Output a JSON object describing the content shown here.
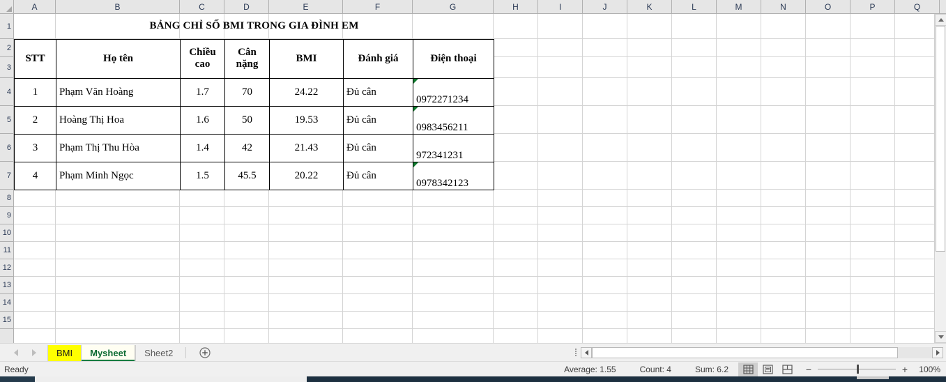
{
  "app": {
    "name": "Excel Spreadsheet"
  },
  "grid": {
    "column_headers": [
      "A",
      "B",
      "C",
      "D",
      "E",
      "F",
      "G",
      "H",
      "I",
      "J",
      "K",
      "L",
      "M",
      "N",
      "O",
      "P",
      "Q"
    ],
    "row_headers": [
      "1",
      "2",
      "3",
      "4",
      "5",
      "6",
      "7",
      "8",
      "9",
      "10",
      "11",
      "12",
      "13",
      "14",
      "15"
    ]
  },
  "sheet": {
    "title": "BẢNG CHỈ SỐ BMI TRONG GIA ĐÌNH EM",
    "table": {
      "headers": [
        "STT",
        "Họ tên",
        "Chiều cao",
        "Cân nặng",
        "BMI",
        "Đánh giá",
        "Điện thoại"
      ],
      "rows": [
        {
          "stt": "1",
          "name": "Phạm Văn Hoàng",
          "height": "1.7",
          "weight": "70",
          "bmi": "24.22",
          "rating": "Đủ cân",
          "phone": "0972271234"
        },
        {
          "stt": "2",
          "name": "Hoàng Thị Hoa",
          "height": "1.6",
          "weight": "50",
          "bmi": "19.53",
          "rating": "Đủ cân",
          "phone": "0983456211"
        },
        {
          "stt": "3",
          "name": "Phạm  Thị Thu Hòa",
          "height": "1.4",
          "weight": "42",
          "bmi": "21.43",
          "rating": "Đủ cân",
          "phone": "972341231"
        },
        {
          "stt": "4",
          "name": "Phạm Minh Ngọc",
          "height": "1.5",
          "weight": "45.5",
          "bmi": "20.22",
          "rating": "Đủ cân",
          "phone": "0978342123"
        }
      ]
    }
  },
  "tabs": {
    "items": [
      {
        "label": "BMI",
        "state": "yellow"
      },
      {
        "label": "Mysheet",
        "state": "active"
      },
      {
        "label": "Sheet2",
        "state": "plain"
      }
    ],
    "add_label": "+"
  },
  "status": {
    "ready": "Ready",
    "average": "Average: 1.55",
    "count": "Count: 4",
    "sum": "Sum: 6.2",
    "zoom": "100%",
    "zoom_out": "−",
    "zoom_in": "+"
  },
  "colors": {
    "tab_highlight": "#ffff00",
    "active_tab_text": "#0d6b33",
    "active_tab_underline": "#107c41",
    "error_triangle": "#0f7b2e",
    "header_text": "#2b3a55"
  }
}
